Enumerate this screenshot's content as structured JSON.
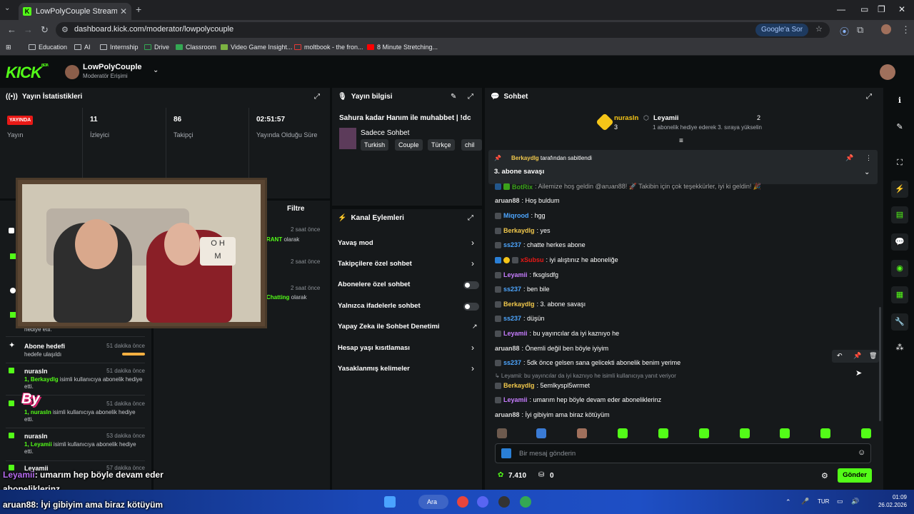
{
  "browser": {
    "tab_title": "LowPolyCouple Stream - Kick D",
    "url": "dashboard.kick.com/moderator/lowpolycouple",
    "google_search": "Google'a Sor",
    "bookmarks": [
      "Education",
      "AI",
      "Internship",
      "Drive",
      "Classroom",
      "Video Game Insight...",
      "moltbook - the fron...",
      "8 Minute Stretching..."
    ]
  },
  "header": {
    "logo": "KICK",
    "logo_sup": "BETA",
    "channel_name": "LowPolyCouple",
    "channel_role": "Moderatör Erişimi"
  },
  "stats": {
    "title": "Yayın İstatistikleri",
    "live_badge": "YAYINDA",
    "live_label": "Yayın",
    "viewers": "11",
    "viewers_label": "İzleyici",
    "followers": "86",
    "followers_label": "Takipçi",
    "uptime": "02:51:57",
    "uptime_label": "Yayında Olduğu Süre"
  },
  "stream_info": {
    "title": "Yayın bilgisi",
    "stream_title": "Sahura kadar Hanım ile muhabbet | !dc",
    "category": "Sadece Sohbet",
    "tags": [
      "Turkish",
      "Couple",
      "Türkçe",
      "chil"
    ]
  },
  "actions": {
    "title": "Kanal Eylemleri",
    "items": [
      "Yavaş mod",
      "Takipçilere özel sohbet",
      "Abonelere özel sohbet",
      "Yalnızca ifadelerle sohbet",
      "Yapay Zeka ile Sohbet Denetimi",
      "Hesap yaşı kısıtlaması",
      "Yasaklanmış kelimeler"
    ]
  },
  "activity": {
    "filter": "Filtre",
    "partial": [
      {
        "time": "2 saat önce",
        "tail": "RANT",
        "tail_rest": " olarak"
      },
      {
        "time": "2 saat önce"
      },
      {
        "time": "2 saat önce",
        "tail": "Chatting",
        "tail_rest": " olarak"
      }
    ],
    "hidden_desc": "hediye etti.",
    "items": [
      {
        "name": "Abone hedefi",
        "time": "51 dakika önce",
        "desc": "hedefe ulaşıldı"
      },
      {
        "name": "nurasln",
        "time": "51 dakika önce",
        "desc_g": "1, Berkaydlg",
        "desc": " isimli kullanıcıya abonelik hediye etti."
      },
      {
        "name": "nurasln",
        "time": "51 dakika önce",
        "desc_g": "1, nurasln",
        "desc": " isimli kullanıcıya abonelik hediye etti."
      },
      {
        "name": "nurasln",
        "time": "53 dakika önce",
        "desc_g": "1, Leyamii",
        "desc": " isimli kullanıcıya abonelik hediye etti."
      },
      {
        "name": "Leyamii",
        "time": "57 dakika önce",
        "desc": ""
      }
    ]
  },
  "chat": {
    "title": "Sohbet",
    "leader1_name": "nurasln",
    "leader1_count": "3",
    "leader2_name": "Leyamii",
    "leader2_count": "2",
    "leader2_desc": "1 abonelik hediye ederek 3. sıraya yükselin",
    "pinned_by": "Berkaydlg",
    "pinned_by_rest": " tarafından sabitlendi",
    "pinned_text": "3. abone savaşı",
    "messages": [
      {
        "user": "BotRix",
        "color": "#53fc18",
        "text": ": Ailemize hoş geldin @aruan88! 🚀 Takibin için çok teşekkürler, iyi ki geldin! 🎉"
      },
      {
        "user": "aruan88",
        "color": "#d7d7d7",
        "text": ": Hoş buldum"
      },
      {
        "user": "Miqrood",
        "color": "#4da6ff",
        "text": ": hgg"
      },
      {
        "user": "Berkaydlg",
        "color": "#f2c94c",
        "text": ": yes"
      },
      {
        "user": "ss237",
        "color": "#4da6ff",
        "text": ": chatte herkes abone"
      },
      {
        "user": "xSubsu",
        "color": "#e91916",
        "text": ": iyi alıştınız he aboneliğe"
      },
      {
        "user": "Leyamii",
        "color": "#c77dff",
        "text": ": fksglsdfg"
      },
      {
        "user": "ss237",
        "color": "#4da6ff",
        "text": ": ben bile"
      },
      {
        "user": "Berkaydlg",
        "color": "#f2c94c",
        "text": ": 3. abone savaşı"
      },
      {
        "user": "ss237",
        "color": "#4da6ff",
        "text": ": düşün"
      },
      {
        "user": "Leyamii",
        "color": "#c77dff",
        "text": ": bu yayıncılar da iyi kaznıyo he"
      },
      {
        "user": "aruan88",
        "color": "#d7d7d7",
        "text": ": Önemli değil ben böyle iyiyim"
      },
      {
        "user": "ss237",
        "color": "#4da6ff",
        "text": ": 5dk önce gelsen sana gelicekti abonelik benim yerime"
      },
      {
        "user": "Berkaydlg",
        "color": "#f2c94c",
        "text": ": 5emlkyspl5wrmet"
      },
      {
        "user": "Leyamii",
        "color": "#c77dff",
        "text": ": umarım hep böyle devam eder aboneliklerinz"
      },
      {
        "user": "aruan88",
        "color": "#d7d7d7",
        "text": ": İyi gibiyim ama biraz kötüyüm"
      }
    ],
    "reply_note": "↳ Leyamii: bu yayıncılar da iyi kaznıyo he isimli kullanıcıya yanıt veriyor",
    "input_placeholder": "Bir mesaj gönderin",
    "points": "7.410",
    "other_count": "0",
    "send": "Gönder"
  },
  "caption": {
    "line1_user": "Leyamii",
    "line1_text": ": umarım hep böyle devam eder",
    "line2": "aboneliklerinz",
    "line3_user": "aruan88",
    "line3_text": ": İyi gibiyim ama biraz kötüyüm",
    "overlay": "By"
  },
  "taskbar": {
    "search": "Ara",
    "lang": "TUR",
    "time": "01:09",
    "date": "26.02.2026"
  }
}
